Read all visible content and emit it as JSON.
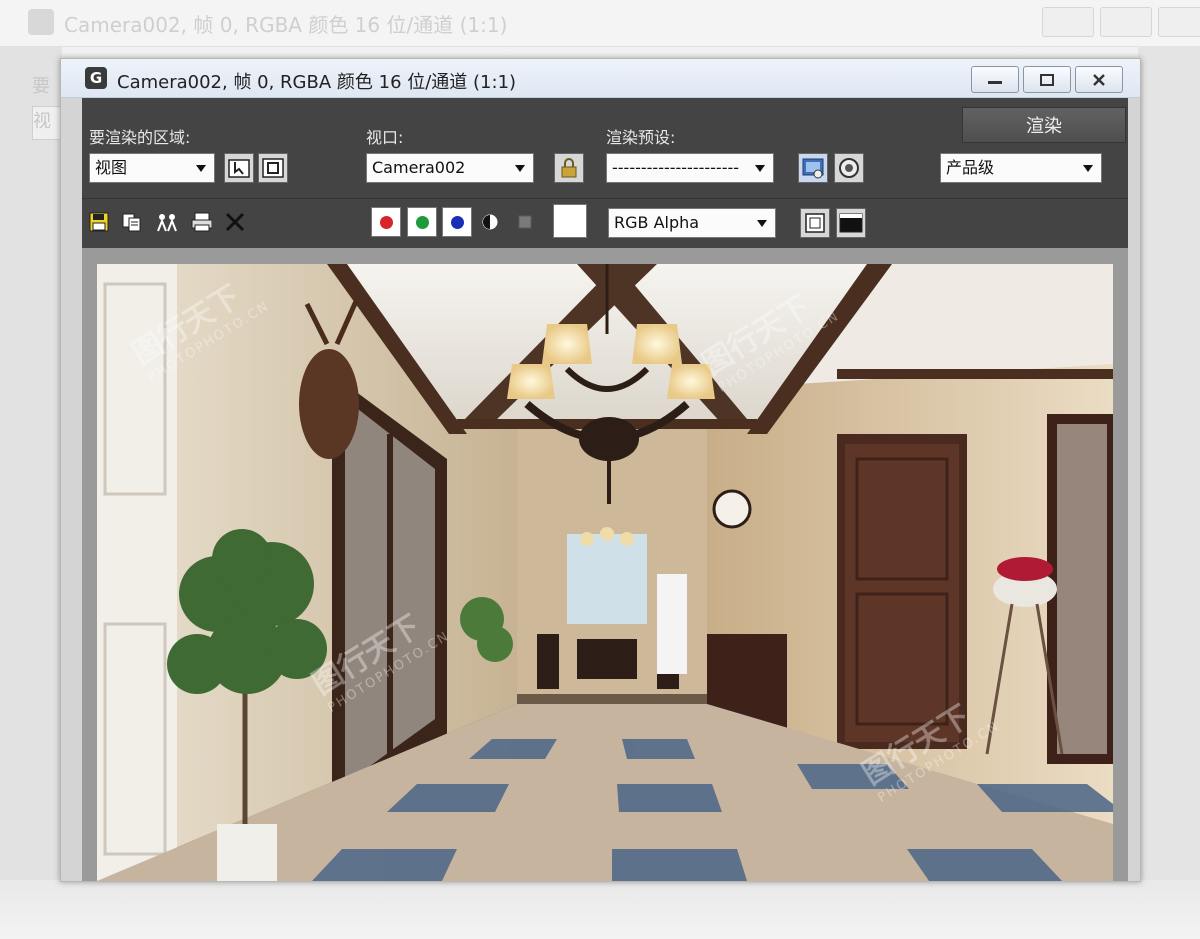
{
  "window": {
    "title": "Camera002, 帧 0, RGBA 颜色 16 位/通道 (1:1)"
  },
  "background_window": {
    "title": "Camera002, 帧 0, RGBA 颜色 16 位/通道 (1:1)",
    "side_label": "要",
    "side_box": "视"
  },
  "toolbar": {
    "area_label": "要渲染的区域:",
    "area_value": "视图",
    "viewport_label": "视口:",
    "viewport_value": "Camera002",
    "preset_label": "渲染预设:",
    "preset_value": "----------------------",
    "render_button": "渲染",
    "quality_value": "产品级",
    "channel_value": "RGB Alpha"
  },
  "channels": {
    "red": "#d8232a",
    "green": "#1f9a3a",
    "blue": "#1a2fb8"
  },
  "icons": [
    "save-icon",
    "copy-icon",
    "clone-icon",
    "print-icon",
    "clear-icon",
    "edit-region-icon",
    "auto-region-icon",
    "lock-icon",
    "render-setup-icon",
    "environment-icon",
    "display-alpha-icon",
    "monochrome-icon",
    "color-swatch-icon",
    "toggle-ui-overlay-icon",
    "toggle-ui-icon"
  ],
  "watermark": {
    "brand": "图行天下",
    "site": "PHOTOPHOTO.CN"
  }
}
